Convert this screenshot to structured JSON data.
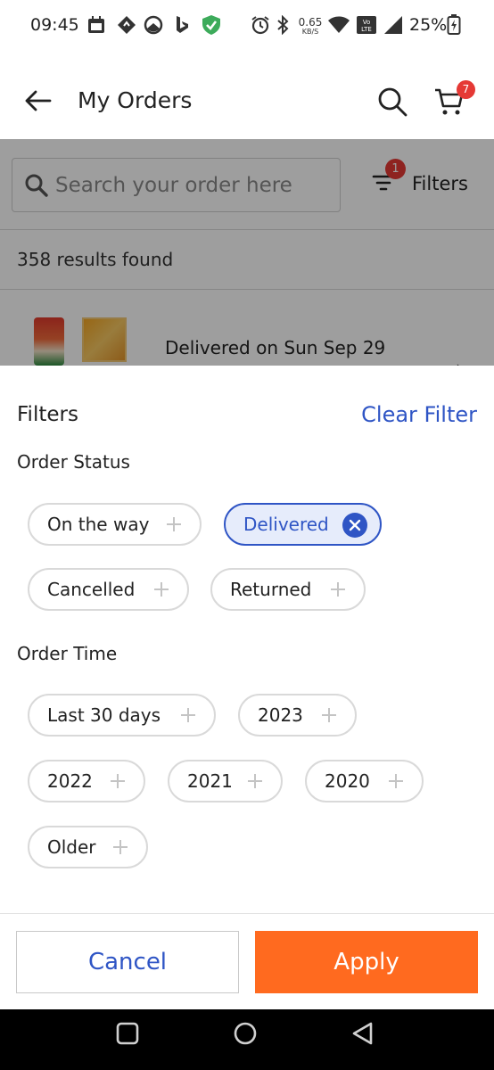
{
  "status_bar": {
    "time": "09:45",
    "speed_value": "0.65",
    "speed_unit": "KB/S",
    "volte_label": "VoLTE",
    "battery_percent": "25%"
  },
  "header": {
    "title": "My Orders",
    "cart_count": "7"
  },
  "order_list": {
    "search_placeholder": "Search your order here",
    "filters_label": "Filters",
    "filter_count": "1",
    "results_text": "358 results found",
    "first_order": {
      "status_text": "Delivered on Sun Sep 29"
    }
  },
  "filter_sheet": {
    "title": "Filters",
    "clear_label": "Clear Filter",
    "order_status": {
      "label": "Order Status",
      "chips": [
        {
          "label": "On the way",
          "selected": false
        },
        {
          "label": "Delivered",
          "selected": true
        },
        {
          "label": "Cancelled",
          "selected": false
        },
        {
          "label": "Returned",
          "selected": false
        }
      ]
    },
    "order_time": {
      "label": "Order Time",
      "chips": [
        {
          "label": "Last 30 days",
          "selected": false
        },
        {
          "label": "2023",
          "selected": false
        },
        {
          "label": "2022",
          "selected": false
        },
        {
          "label": "2021",
          "selected": false
        },
        {
          "label": "2020",
          "selected": false
        },
        {
          "label": "Older",
          "selected": false
        }
      ]
    },
    "cancel_label": "Cancel",
    "apply_label": "Apply"
  },
  "colors": {
    "accent_blue": "#2f55c5",
    "apply_orange": "#ff6a1f",
    "badge_red": "#e53935"
  }
}
